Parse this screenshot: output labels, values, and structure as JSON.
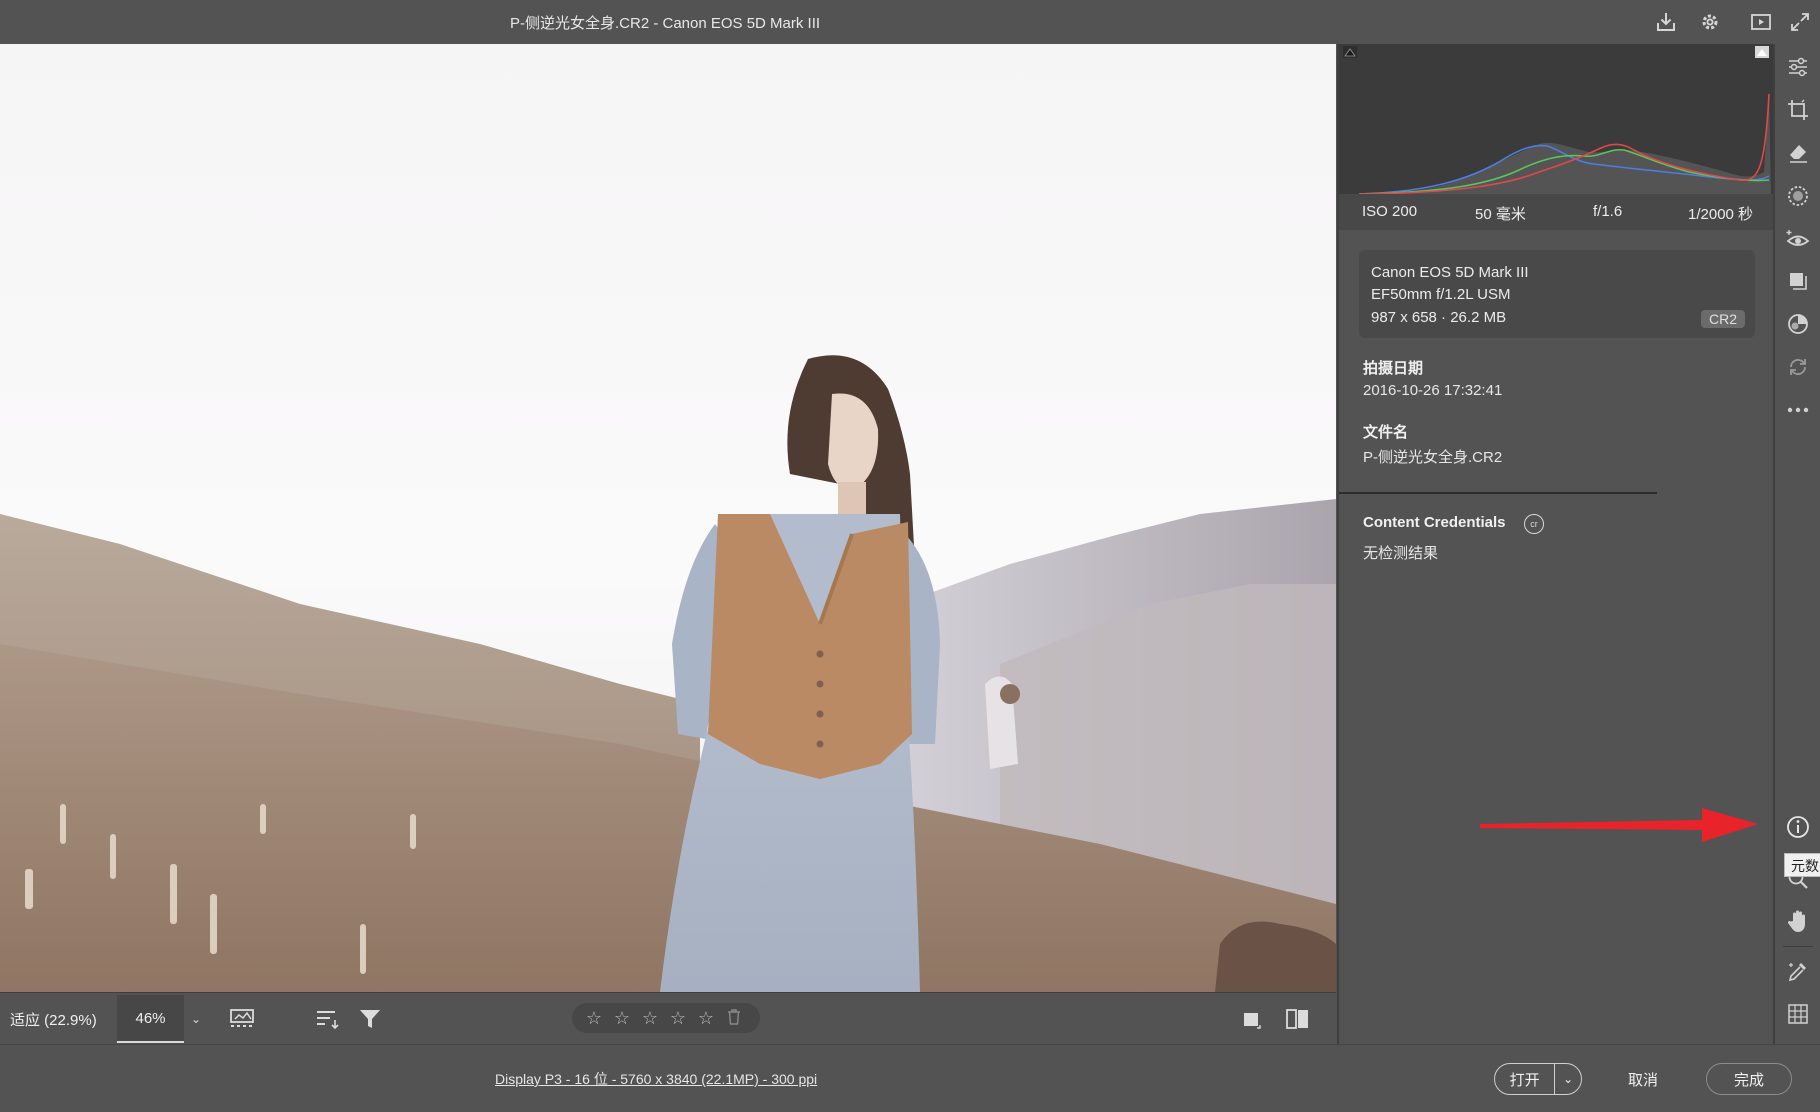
{
  "window": {
    "title": "P-侧逆光女全身.CR2 -  Canon EOS 5D Mark III",
    "icons": [
      "download-icon",
      "gear-icon",
      "play-icon",
      "expand-icon"
    ]
  },
  "canvas": {
    "image_description_icon": "photo-image"
  },
  "bottom_toolbar": {
    "zoom_fit": "适应 (22.9%)",
    "zoom_percent": "46%",
    "rating_stars": 0,
    "rating_max": 5,
    "icons": [
      "filmstrip-icon",
      "sort-icon",
      "filter-icon",
      "single-view-icon",
      "compare-view-icon",
      "trash-icon"
    ]
  },
  "status": {
    "info": "Display P3 - 16 位 - 5760 x 3840 (22.1MP) - 300 ppi",
    "open_label": "打开",
    "cancel_label": "取消",
    "done_label": "完成"
  },
  "panel": {
    "exif": {
      "iso": "ISO 200",
      "focal": "50 毫米",
      "aperture": "f/1.6",
      "shutter": "1/2000 秒"
    },
    "camera": {
      "model": "Canon EOS 5D Mark III",
      "lens": "EF50mm f/1.2L USM",
      "size": "987 x 658 · 26.2 MB",
      "format_badge": "CR2"
    },
    "capture_date_label": "拍摄日期",
    "capture_date": "2016-10-26 17:32:41",
    "filename_label": "文件名",
    "filename": "P-侧逆光女全身.CR2",
    "credentials_label": "Content Credentials",
    "credentials_value": "无检测结果"
  },
  "tool_strip": {
    "icons": [
      "edit-sliders-icon",
      "crop-icon",
      "eraser-icon",
      "mask-icon",
      "redeye-icon",
      "presets-icon",
      "color-icon",
      "snapshot-icon",
      "more-icon",
      "metadata-info-icon",
      "zoom-icon",
      "hand-icon",
      "eyedropper-icon",
      "grid-icon"
    ],
    "tooltip": "元数"
  },
  "colors": {
    "bg": "#535353",
    "panel_dark": "#3b3b3b",
    "arrow": "#e8232a",
    "hist_red": "#e0484a",
    "hist_green": "#58c65a",
    "hist_blue": "#4c7ee0"
  }
}
